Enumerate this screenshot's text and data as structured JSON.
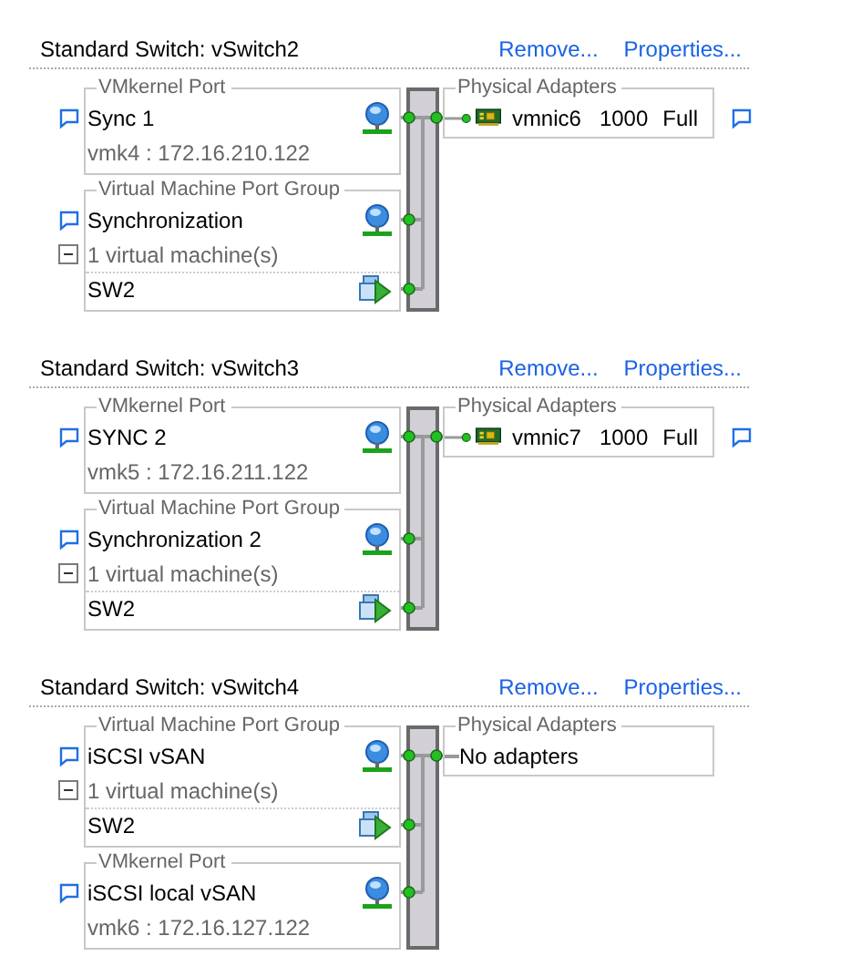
{
  "switches": [
    {
      "title": "Standard Switch: vSwitch2",
      "actions": [
        "Remove...",
        "Properties..."
      ],
      "groups": [
        {
          "kind": "vmkernel",
          "legend": "VMkernel Port",
          "name": "Sync 1",
          "detail": "vmk4 : 172.16.210.122"
        },
        {
          "kind": "vm_group",
          "legend": "Virtual Machine Port Group",
          "name": "Synchronization",
          "count": "1 virtual machine(s)",
          "expanded": true,
          "vms": [
            "SW2"
          ]
        }
      ],
      "adapters": {
        "legend": "Physical Adapters",
        "items": [
          {
            "name": "vmnic6",
            "speed": "1000",
            "duplex": "Full"
          }
        ]
      }
    },
    {
      "title": "Standard Switch: vSwitch3",
      "actions": [
        "Remove...",
        "Properties..."
      ],
      "groups": [
        {
          "kind": "vmkernel",
          "legend": "VMkernel Port",
          "name": "SYNC 2",
          "detail": "vmk5 : 172.16.211.122"
        },
        {
          "kind": "vm_group",
          "legend": "Virtual Machine Port Group",
          "name": "Synchronization 2",
          "count": "1 virtual machine(s)",
          "expanded": true,
          "vms": [
            "SW2"
          ]
        }
      ],
      "adapters": {
        "legend": "Physical Adapters",
        "items": [
          {
            "name": "vmnic7",
            "speed": "1000",
            "duplex": "Full"
          }
        ]
      }
    },
    {
      "title": "Standard Switch: vSwitch4",
      "actions": [
        "Remove...",
        "Properties..."
      ],
      "groups": [
        {
          "kind": "vm_group",
          "legend": "Virtual Machine Port Group",
          "name": "iSCSI vSAN",
          "count": "1 virtual machine(s)",
          "expanded": true,
          "vms": [
            "SW2"
          ]
        },
        {
          "kind": "vmkernel",
          "legend": "VMkernel Port",
          "name": "iSCSI local vSAN",
          "detail": "vmk6 : 172.16.127.122"
        }
      ],
      "adapters": {
        "legend": "Physical Adapters",
        "empty_text": "No adapters"
      }
    }
  ]
}
